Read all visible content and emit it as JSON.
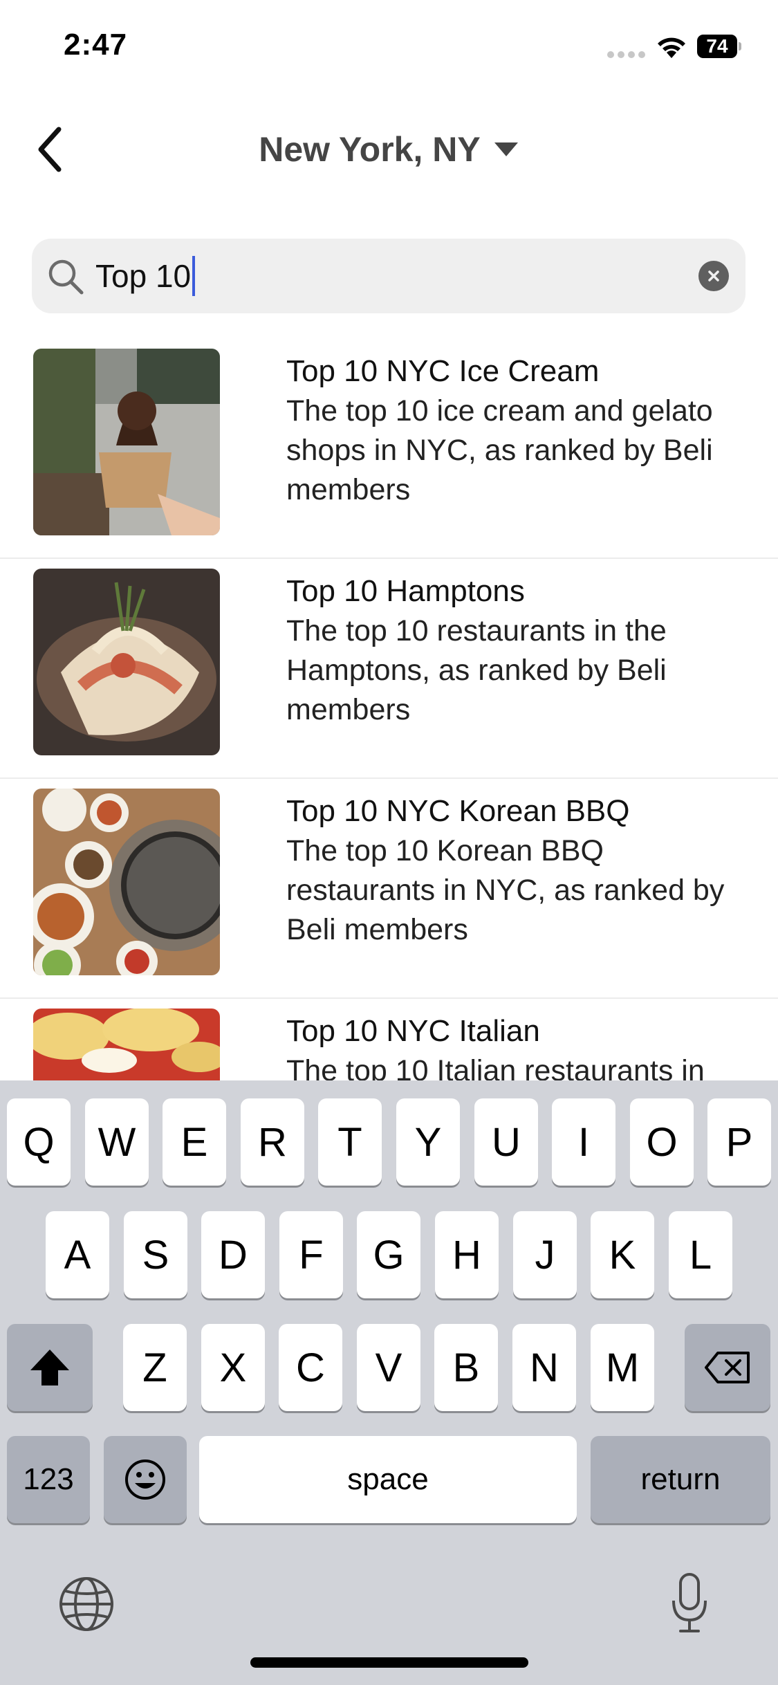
{
  "status": {
    "time": "2:47",
    "battery": "74"
  },
  "nav": {
    "location": "New York, NY"
  },
  "search": {
    "value": "Top 10"
  },
  "results": [
    {
      "title": "Top 10 NYC Ice Cream",
      "description": "The top 10 ice cream and gelato shops in NYC, as ranked by Beli members"
    },
    {
      "title": "Top 10 Hamptons",
      "description": "The top 10 restaurants in the Hamptons, as ranked by Beli members"
    },
    {
      "title": "Top 10 NYC Korean BBQ",
      "description": "The top 10 Korean BBQ restaurants in NYC, as ranked by Beli members"
    },
    {
      "title": "Top 10 NYC Italian",
      "description": "The top 10 Italian restaurants in"
    }
  ],
  "keyboard": {
    "row1": [
      "Q",
      "W",
      "E",
      "R",
      "T",
      "Y",
      "U",
      "I",
      "O",
      "P"
    ],
    "row2": [
      "A",
      "S",
      "D",
      "F",
      "G",
      "H",
      "J",
      "K",
      "L"
    ],
    "row3": [
      "Z",
      "X",
      "C",
      "V",
      "B",
      "N",
      "M"
    ],
    "numbers_label": "123",
    "space_label": "space",
    "return_label": "return"
  },
  "colors": {
    "caret": "#3b5bdb",
    "keyboard_bg": "#d1d3d9",
    "key_dark": "#abafb9"
  }
}
